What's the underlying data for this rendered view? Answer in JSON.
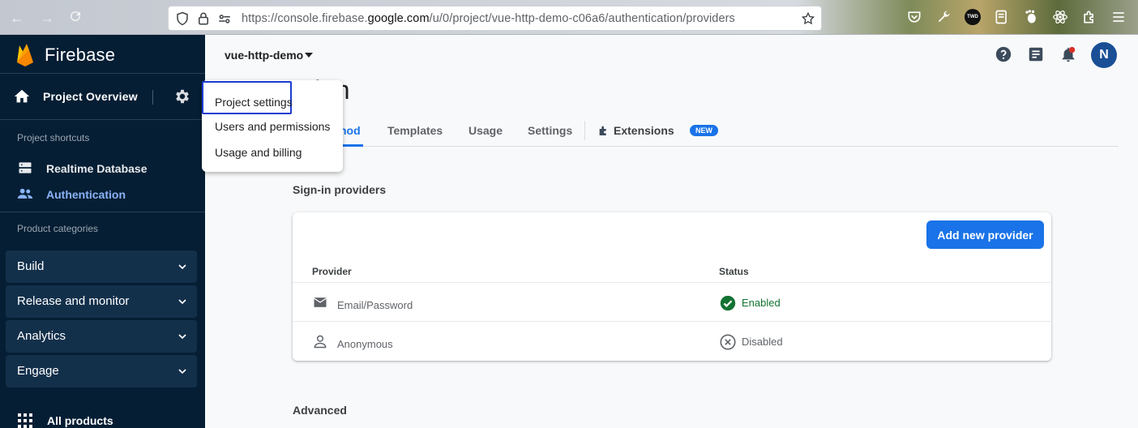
{
  "browser": {
    "url_prefix": "https://console.firebase.",
    "url_domain": "google.com",
    "url_suffix": "/u/0/project/vue-http-demo-c06a6/authentication/providers",
    "ext_label": "TWD"
  },
  "sidebar": {
    "brand": "Firebase",
    "project_overview": "Project Overview",
    "shortcuts_label": "Project shortcuts",
    "shortcuts": [
      {
        "label": "Realtime Database",
        "icon": "database-icon"
      },
      {
        "label": "Authentication",
        "icon": "people-icon"
      }
    ],
    "categories_label": "Product categories",
    "categories": [
      "Build",
      "Release and monitor",
      "Analytics",
      "Engage"
    ],
    "all_products": "All products"
  },
  "menu": {
    "items": [
      "Project settings",
      "Users and permissions",
      "Usage and billing"
    ]
  },
  "main": {
    "project_name": "vue-http-demo",
    "title": "ation",
    "tabs": [
      "hod",
      "Templates",
      "Usage",
      "Settings",
      "Extensions"
    ],
    "new_badge": "NEW",
    "avatar_initial": "N",
    "signin_header": "Sign-in providers",
    "add_provider_button": "Add new provider",
    "table": {
      "headers": [
        "Provider",
        "Status"
      ],
      "rows": [
        {
          "provider": "Email/Password",
          "status": "Enabled"
        },
        {
          "provider": "Anonymous",
          "status": "Disabled"
        }
      ]
    },
    "advanced_header": "Advanced"
  },
  "colors": {
    "sidebar_bg": "#051e34",
    "accent": "#1a73e8",
    "enabled": "#137333",
    "disabled": "#5f6368"
  }
}
